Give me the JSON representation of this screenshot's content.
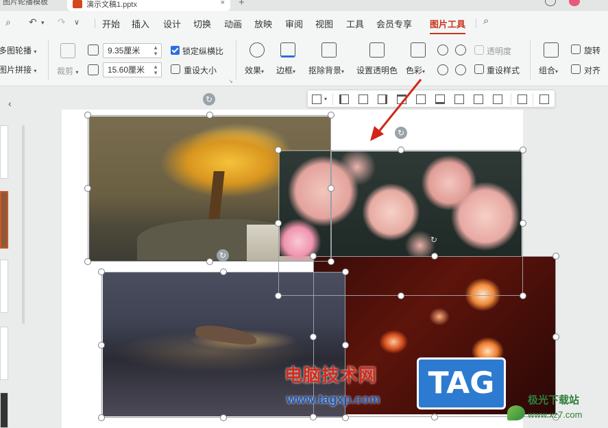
{
  "tabs": {
    "left_tab_label": "图片轮播模板",
    "active_tab_label": "演示文稿1.pptx",
    "close_glyph": "×",
    "new_tab_glyph": "+"
  },
  "menu": {
    "items": [
      "开始",
      "插入",
      "设计",
      "切换",
      "动画",
      "放映",
      "审阅",
      "视图",
      "工具",
      "会员专享",
      "图片工具"
    ],
    "active": "图片工具",
    "search_icon": "search-icon"
  },
  "ribbon": {
    "multi_carousel": "多图轮播",
    "multi_puzzle": "图片拼接",
    "crop": "裁剪",
    "width_value": "9.35厘米",
    "height_value": "15.60厘米",
    "lock_ratio": "锁定纵横比",
    "reset_size": "重设大小",
    "effects": "效果",
    "border": "边框",
    "remove_bg": "抠除背景",
    "set_transparent": "设置透明色",
    "color": "色彩",
    "transparency": "透明度",
    "reset_style": "重设样式",
    "group": "组合",
    "rotate": "旋转",
    "align": "对齐"
  },
  "watermark": {
    "site_cn": "电脑技术网",
    "site_url": "www.tagxp.com",
    "tag_logo": "TAG",
    "download_site": "极光下载站",
    "download_url": "www.xz7.com"
  },
  "colors": {
    "accent": "#c8341c",
    "checkbox": "#2d6ee0",
    "arrow": "#d3241a"
  }
}
